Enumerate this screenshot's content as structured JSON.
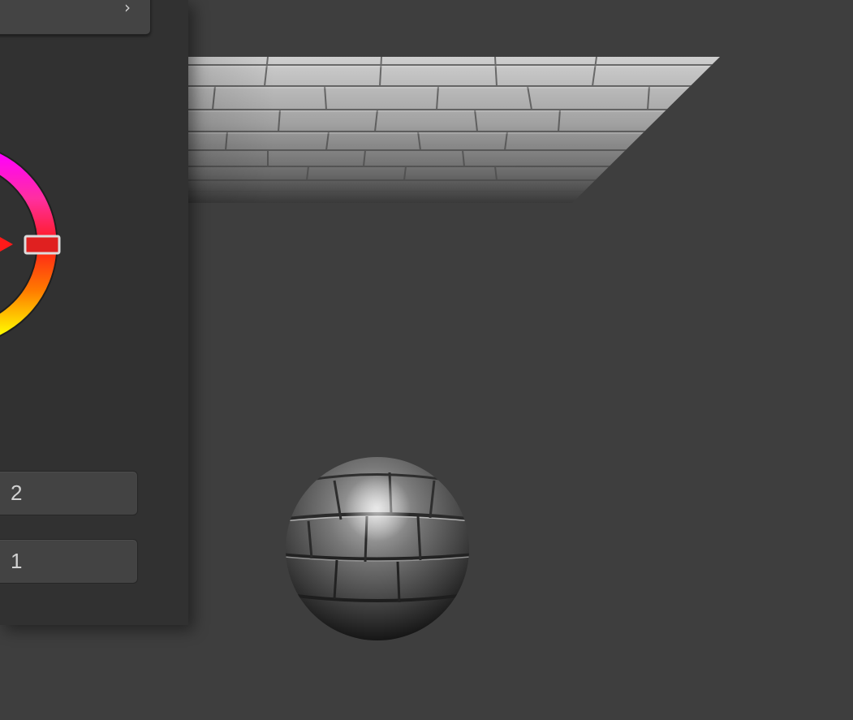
{
  "panel": {
    "top_button": {
      "icon": "chevron-right-icon"
    },
    "hue_wheel": {
      "selected_hue_color": "#ff1a1a"
    },
    "fields": [
      {
        "value": "2"
      },
      {
        "value": "1"
      }
    ]
  },
  "viewport": {
    "floor": {
      "material": "brick"
    },
    "sphere": {
      "material": "brick"
    }
  }
}
